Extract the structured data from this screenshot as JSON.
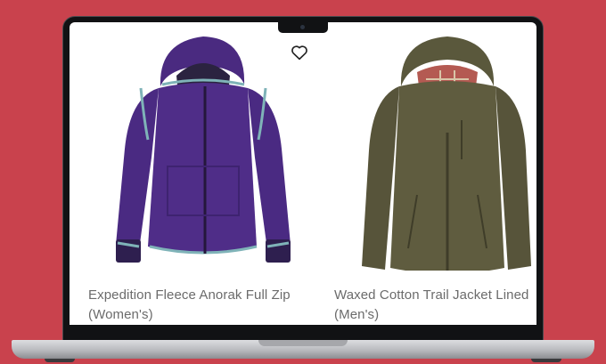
{
  "products": [
    {
      "title_line1": "Expedition Fleece Anorak Full Zip",
      "title_line2": "(Women's)",
      "image": "purple-fleece-jacket",
      "color": "#4f2d88"
    },
    {
      "title_line1": "Waxed Cotton Trail Jacket Lined",
      "title_line2": "(Men's)",
      "image": "olive-waxed-jacket",
      "color": "#5d5a3e"
    }
  ],
  "wishlist": {
    "icon": "heart-outline-icon"
  },
  "colors": {
    "background": "#c9424d",
    "text": "#6b6b6b"
  }
}
